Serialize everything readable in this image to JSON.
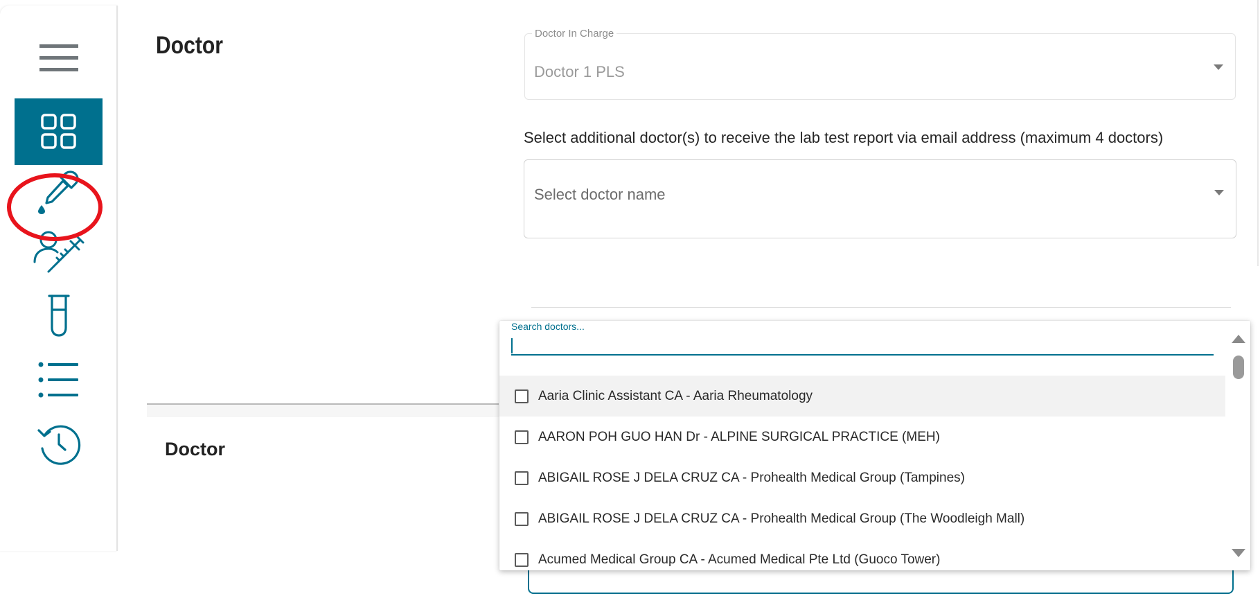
{
  "sidebar": {
    "items": [
      {
        "name": "menu",
        "icon": "hamburger-menu-icon",
        "active": false
      },
      {
        "name": "dashboard",
        "icon": "dashboard-grid-icon",
        "active": true
      },
      {
        "name": "lab-test",
        "icon": "dropper-icon",
        "active": false,
        "highlighted": true
      },
      {
        "name": "vaccination",
        "icon": "user-syringe-icon",
        "active": false
      },
      {
        "name": "test-tube",
        "icon": "test-tube-icon",
        "active": false
      },
      {
        "name": "list",
        "icon": "list-icon",
        "active": false
      },
      {
        "name": "history",
        "icon": "history-icon",
        "active": false
      }
    ],
    "accent": "#00708e",
    "highlight_color": "#e8141c"
  },
  "section1": {
    "title": "Doctor",
    "doctor_in_charge": {
      "legend": "Doctor In Charge",
      "value": "Doctor 1 PLS"
    },
    "helper_text": "Select additional doctor(s) to receive the lab test report via email address (maximum 4 doctors)",
    "select_placeholder": "Select doctor name"
  },
  "section2": {
    "title": "Doctor"
  },
  "dropdown": {
    "search_label": "Search doctors...",
    "search_value": "",
    "options": [
      {
        "label": "Aaria Clinic Assistant CA - Aaria Rheumatology",
        "checked": false,
        "hover": true
      },
      {
        "label": "AARON POH GUO HAN Dr - ALPINE SURGICAL PRACTICE (MEH)",
        "checked": false,
        "hover": false
      },
      {
        "label": "ABIGAIL ROSE J DELA CRUZ CA - Prohealth Medical Group (Tampines)",
        "checked": false,
        "hover": false
      },
      {
        "label": "ABIGAIL ROSE J DELA CRUZ CA - Prohealth Medical Group (The Woodleigh Mall)",
        "checked": false,
        "hover": false
      },
      {
        "label": "Acumed Medical Group CA - Acumed Medical Pte Ltd (Guoco Tower)",
        "checked": false,
        "hover": false
      }
    ]
  }
}
